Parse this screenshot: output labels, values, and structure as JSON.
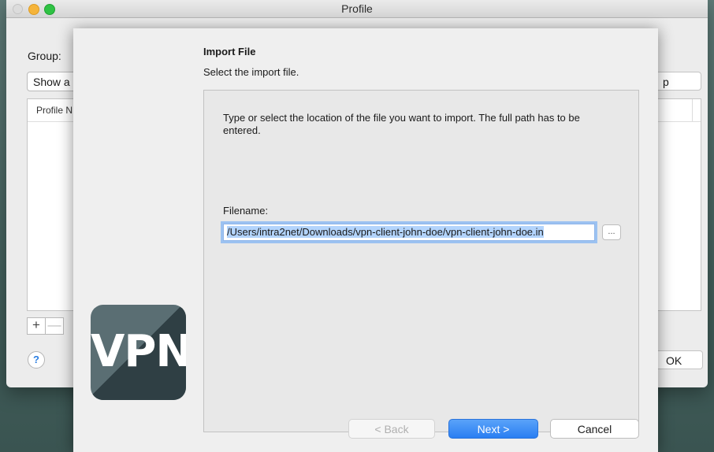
{
  "window": {
    "title": "Profile"
  },
  "main": {
    "group_label": "Group:",
    "group_select_value": "Show a",
    "right_button_label": "p",
    "list_header": "Profile N",
    "add_label": "+",
    "remove_label": "—",
    "help_label": "?",
    "ok_label": "OK"
  },
  "sheet": {
    "title": "Import File",
    "subtitle": "Select the import file.",
    "description": "Type or select the location of the file you want to import. The full path has to be entered.",
    "filename_label": "Filename:",
    "filename_value": "/Users/intra2net/Downloads/vpn-client-john-doe/vpn-client-john-doe.in",
    "browse_label": "...",
    "logo_text": "VPN",
    "back_label": "< Back",
    "next_label": "Next >",
    "cancel_label": "Cancel"
  },
  "colors": {
    "accent": "#2a7ef2",
    "selection": "#b3d4fc",
    "logo_bg": "#5a6e73"
  }
}
